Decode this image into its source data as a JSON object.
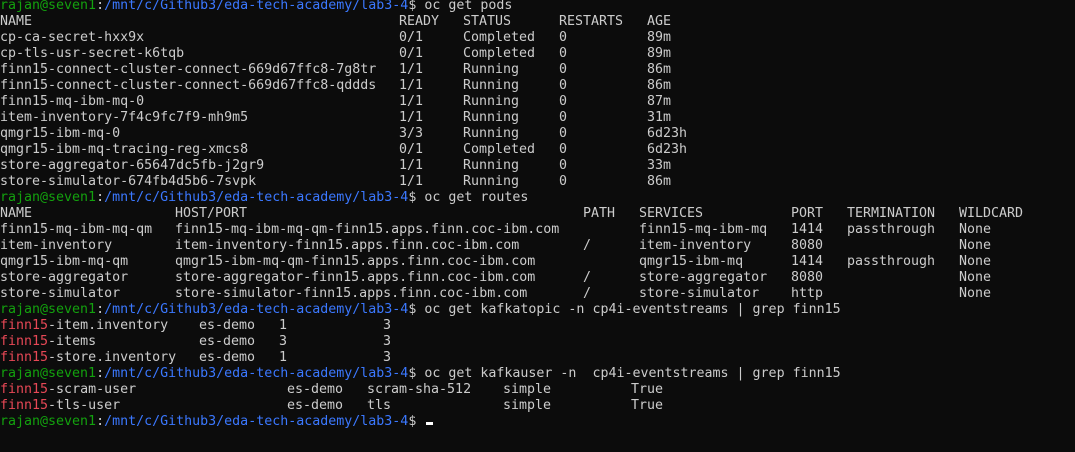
{
  "terminal": {
    "user_host": "rajan@seven1",
    "path": "/mnt/c/Github3/eda-tech-academy/lab3-4",
    "prompt_char": "$ ",
    "colors": {
      "background": "#0c0c0c",
      "text": "#cccccc",
      "user": "#13a10e",
      "path": "#3b78ff",
      "match": "#e74856"
    }
  },
  "commands": {
    "pods": "oc get pods",
    "routes": "oc get routes",
    "kafkatopic": "oc get kafkatopic -n cp4i-eventstreams | grep finn15",
    "kafkauser": "oc get kafkauser -n  cp4i-eventstreams | grep finn15",
    "empty": ""
  },
  "pods": {
    "headers": [
      "NAME",
      "READY",
      "STATUS",
      "RESTARTS",
      "AGE"
    ],
    "rows": [
      [
        "cp-ca-secret-hxx9x",
        "0/1",
        "Completed",
        "0",
        "89m"
      ],
      [
        "cp-tls-usr-secret-k6tqb",
        "0/1",
        "Completed",
        "0",
        "89m"
      ],
      [
        "finn15-connect-cluster-connect-669d67ffc8-7g8tr",
        "1/1",
        "Running",
        "0",
        "86m"
      ],
      [
        "finn15-connect-cluster-connect-669d67ffc8-qddds",
        "1/1",
        "Running",
        "0",
        "86m"
      ],
      [
        "finn15-mq-ibm-mq-0",
        "1/1",
        "Running",
        "0",
        "87m"
      ],
      [
        "item-inventory-7f4c9fc7f9-mh9m5",
        "1/1",
        "Running",
        "0",
        "31m"
      ],
      [
        "qmgr15-ibm-mq-0",
        "3/3",
        "Running",
        "0",
        "6d23h"
      ],
      [
        "qmgr15-ibm-mq-tracing-reg-xmcs8",
        "0/1",
        "Completed",
        "0",
        "6d23h"
      ],
      [
        "store-aggregator-65647dc5fb-j2gr9",
        "1/1",
        "Running",
        "0",
        "33m"
      ],
      [
        "store-simulator-674fb4d5b6-7svpk",
        "1/1",
        "Running",
        "0",
        "86m"
      ]
    ]
  },
  "routes": {
    "headers": [
      "NAME",
      "HOST/PORT",
      "PATH",
      "SERVICES",
      "PORT",
      "TERMINATION",
      "WILDCARD"
    ],
    "rows": [
      [
        "finn15-mq-ibm-mq-qm",
        "finn15-mq-ibm-mq-qm-finn15.apps.finn.coc-ibm.com",
        "",
        "finn15-mq-ibm-mq",
        "1414",
        "passthrough",
        "None"
      ],
      [
        "item-inventory",
        "item-inventory-finn15.apps.finn.coc-ibm.com",
        "/",
        "item-inventory",
        "8080",
        "",
        "None"
      ],
      [
        "qmgr15-ibm-mq-qm",
        "qmgr15-ibm-mq-qm-finn15.apps.finn.coc-ibm.com",
        "",
        "qmgr15-ibm-mq",
        "1414",
        "passthrough",
        "None"
      ],
      [
        "store-aggregator",
        "store-aggregator-finn15.apps.finn.coc-ibm.com",
        "/",
        "store-aggregator",
        "8080",
        "",
        "None"
      ],
      [
        "store-simulator",
        "store-simulator-finn15.apps.finn.coc-ibm.com",
        "/",
        "store-simulator",
        "http",
        "",
        "None"
      ]
    ]
  },
  "kafkatopics": {
    "match": "finn15",
    "rows": [
      [
        "-item.inventory",
        "es-demo",
        "1",
        "3"
      ],
      [
        "-items",
        "es-demo",
        "3",
        "3"
      ],
      [
        "-store.inventory",
        "es-demo",
        "1",
        "3"
      ]
    ]
  },
  "kafkausers": {
    "match": "finn15",
    "rows": [
      [
        "-scram-user",
        "es-demo",
        "scram-sha-512",
        "simple",
        "True"
      ],
      [
        "-tls-user",
        "es-demo",
        "tls",
        "simple",
        "True"
      ]
    ]
  }
}
